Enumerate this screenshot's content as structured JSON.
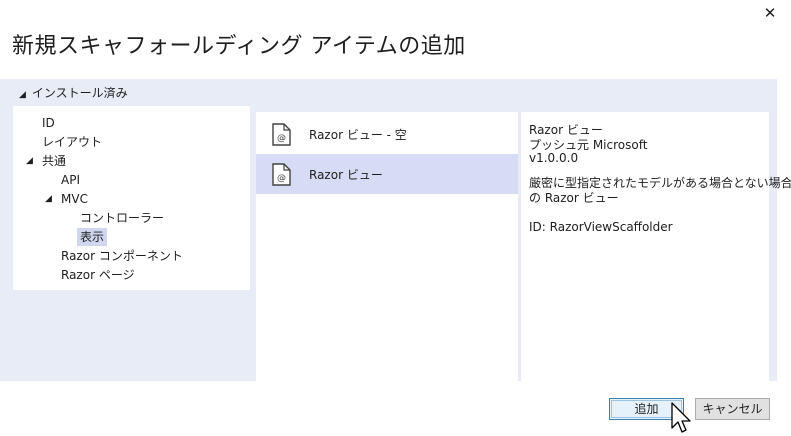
{
  "dialog": {
    "title": "新規スキャフォールディング アイテムの追加",
    "close_glyph": "✕"
  },
  "group": {
    "label": "インストール済み",
    "expanded": true
  },
  "tree": {
    "items": [
      {
        "label": "ID"
      },
      {
        "label": "レイアウト"
      },
      {
        "label": "共通",
        "expanded": true
      },
      {
        "label": "API"
      },
      {
        "label": "MVC",
        "expanded": true
      },
      {
        "label": "コントローラー"
      },
      {
        "label": "表示",
        "selected": true
      },
      {
        "label": "Razor コンポーネント"
      },
      {
        "label": "Razor ページ"
      }
    ]
  },
  "templates": [
    {
      "label": "Razor ビュー - 空",
      "icon": "razor-file-icon",
      "selected": false
    },
    {
      "label": "Razor ビュー",
      "icon": "razor-file-icon",
      "selected": true
    }
  ],
  "details": {
    "name": "Razor ビュー",
    "author": "プッシュ元 Microsoft",
    "version": "v1.0.0.0",
    "description_line1": "厳密に型指定されたモデルがある場合とない場合",
    "description_line2": "の Razor ビュー",
    "id": "ID: RazorViewScaffolder"
  },
  "buttons": {
    "add": "追加",
    "cancel": "キャンセル"
  },
  "colors": {
    "panel_bg": "#e8ecf6",
    "selection": "#d6dcf3",
    "primary_border": "#3c7fb1"
  }
}
